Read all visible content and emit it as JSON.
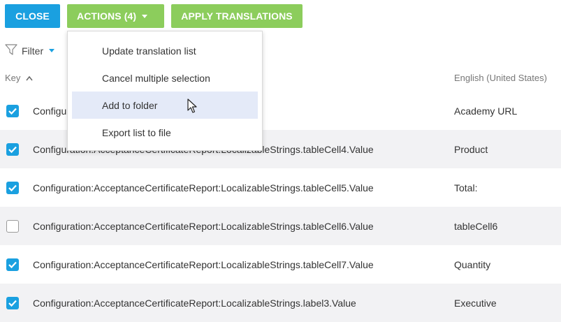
{
  "toolbar": {
    "close_label": "CLOSE",
    "actions_label": "ACTIONS (4)",
    "apply_label": "APPLY TRANSLATIONS"
  },
  "filter": {
    "label": "Filter"
  },
  "columns": {
    "key": "Key",
    "language": "English (United States)"
  },
  "menu": {
    "items": [
      "Update translation list",
      "Cancel multiple selection",
      "Add to folder",
      "Export list to file"
    ],
    "hovered_index": 2
  },
  "rows": [
    {
      "checked": true,
      "key": "Configu",
      "value": "Academy URL"
    },
    {
      "checked": true,
      "key": "Configuration:AcceptanceCertificateReport:LocalizableStrings.tableCell4.Value",
      "value": "Product"
    },
    {
      "checked": true,
      "key": "Configuration:AcceptanceCertificateReport:LocalizableStrings.tableCell5.Value",
      "value": "Total:"
    },
    {
      "checked": false,
      "key": "Configuration:AcceptanceCertificateReport:LocalizableStrings.tableCell6.Value",
      "value": "tableCell6"
    },
    {
      "checked": true,
      "key": "Configuration:AcceptanceCertificateReport:LocalizableStrings.tableCell7.Value",
      "value": "Quantity"
    },
    {
      "checked": true,
      "key": "Configuration:AcceptanceCertificateReport:LocalizableStrings.label3.Value",
      "value": "Executive"
    }
  ],
  "colors": {
    "primary_blue": "#1aa0e0",
    "action_green": "#8ccd5c",
    "menu_hover": "#e4eaf8",
    "row_alt": "#f2f2f4"
  }
}
